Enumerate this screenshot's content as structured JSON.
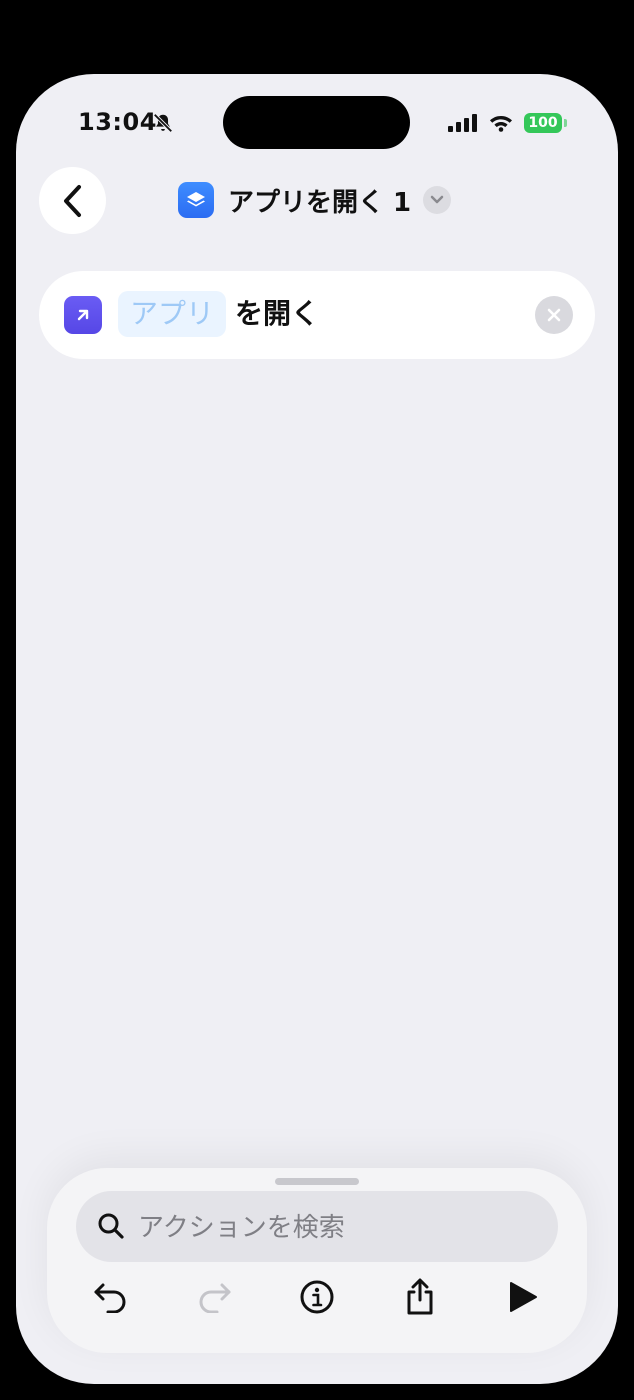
{
  "status_bar": {
    "time": "13:04",
    "battery": "100"
  },
  "nav": {
    "title": "アプリを開く 1"
  },
  "action": {
    "app_placeholder": "アプリ",
    "text": "を開く"
  },
  "search": {
    "placeholder": "アクションを検索"
  },
  "colors": {
    "background": "#efeff4",
    "shortcut_icon": "#2f74f5",
    "action_icon": "#5e50ee",
    "token_bg": "#eaf4ff",
    "token_text": "#9ec9f6",
    "battery": "#34c759"
  },
  "toolbar": {
    "icons": [
      "undo-icon",
      "redo-icon",
      "info-icon",
      "share-icon",
      "play-icon"
    ],
    "redo_enabled": false
  }
}
